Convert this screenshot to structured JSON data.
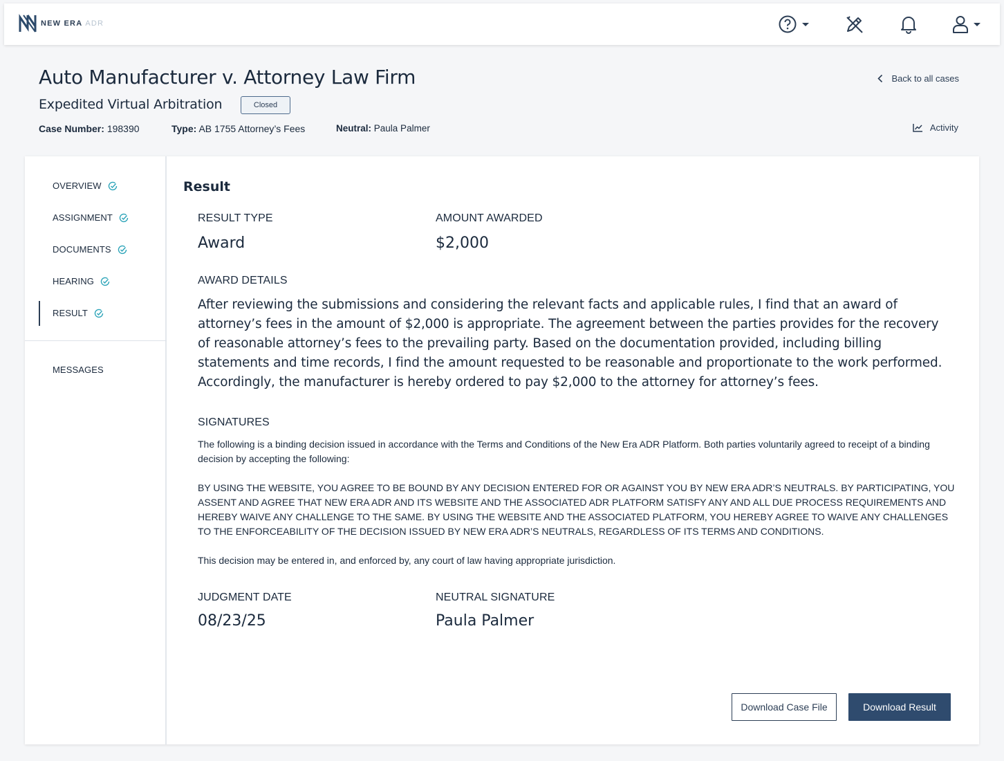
{
  "brand": {
    "name": "NEW ERA",
    "suffix": "ADR"
  },
  "topbar": {
    "icons": [
      "help-icon",
      "chevron-down-icon",
      "edit-pen-icon",
      "bell-icon",
      "user-icon",
      "chevron-down-icon"
    ]
  },
  "case": {
    "title": "Auto Manufacturer v. Attorney Law Firm",
    "subtitle": "Expedited Virtual Arbitration",
    "status": "Closed",
    "case_number_label": "Case Number:",
    "case_number": "198390",
    "type_label": "Type:",
    "type": "AB 1755 Attorney’s Fees",
    "neutral_label": "Neutral:",
    "neutral": "Paula Palmer",
    "back_link": "Back to all cases",
    "activity_link": "Activity"
  },
  "sidebar": {
    "items": [
      {
        "label": "OVERVIEW",
        "complete": true
      },
      {
        "label": "ASSIGNMENT",
        "complete": true
      },
      {
        "label": "DOCUMENTS",
        "complete": true
      },
      {
        "label": "HEARING",
        "complete": true
      },
      {
        "label": "RESULT",
        "complete": true,
        "active": true
      }
    ],
    "messages": "MESSAGES"
  },
  "result": {
    "heading": "Result",
    "result_type_label": "RESULT TYPE",
    "result_type": "Award",
    "amount_label": "AMOUNT AWARDED",
    "amount": "$2,000",
    "award_details_label": "AWARD DETAILS",
    "award_details": "After reviewing the submissions and considering the relevant facts and applicable rules, I find that an award of attorney’s fees in the amount of $2,000 is appropriate. The agreement between the parties provides for the recovery of reasonable attorney’s fees to the prevailing party. Based on the documentation provided, including billing statements and time records, I find the amount requested to be reasonable and proportionate to the work performed. Accordingly, the manufacturer is hereby ordered to pay $2,000 to the attorney for attorney’s fees.",
    "signatures_label": "SIGNATURES",
    "signatures_p1": "The following is a binding decision issued in accordance with the Terms and Conditions of the New Era ADR Platform. Both parties voluntarily agreed to receipt of a binding decision by accepting the following:",
    "signatures_p2": "BY USING THE WEBSITE, YOU AGREE TO BE BOUND BY ANY DECISION ENTERED FOR OR AGAINST YOU BY NEW ERA ADR’S NEUTRALS. BY PARTICIPATING, YOU ASSENT AND AGREE THAT NEW ERA ADR AND ITS WEBSITE AND THE ASSOCIATED ADR PLATFORM SATISFY ANY AND ALL DUE PROCESS REQUIREMENTS AND HEREBY WAIVE ANY CHALLENGE TO THE SAME. BY USING THE WEBSITE AND THE ASSOCIATED PLATFORM, YOU HEREBY AGREE TO WAIVE ANY CHALLENGES TO THE ENFORCEABILITY OF THE DECISION ISSUED BY NEW ERA ADR’S NEUTRALS, REGARDLESS OF ITS TERMS AND CONDITIONS.",
    "signatures_p3": "This decision may be entered in, and enforced by, any court of law having appropriate jurisdiction.",
    "judgment_date_label": "JUDGMENT DATE",
    "judgment_date": "08/23/25",
    "neutral_signature_label": "NEUTRAL SIGNATURE",
    "neutral_signature": "Paula Palmer"
  },
  "buttons": {
    "download_case_file": "Download Case File",
    "download_result": "Download Result"
  },
  "colors": {
    "primary": "#2f4b6e",
    "text": "#1b2a3d",
    "check": "#2aa3b8",
    "background": "#f5f6f8"
  }
}
